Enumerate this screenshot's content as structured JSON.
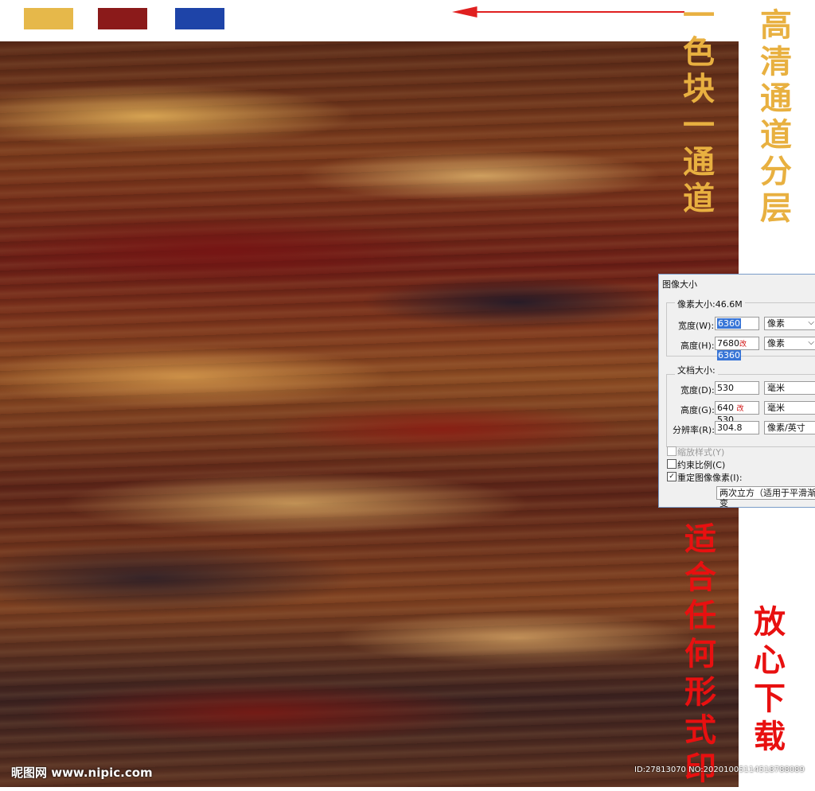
{
  "swatches": [
    {
      "name": "gold",
      "color": "#e6b84a"
    },
    {
      "name": "maroon",
      "color": "#8b1a1a"
    },
    {
      "name": "blue",
      "color": "#1e44a8"
    }
  ],
  "vertical_texts": {
    "left_top": [
      "一",
      "色",
      "块",
      "一",
      "通",
      "道"
    ],
    "right_top": [
      "高",
      "清",
      "通",
      "道",
      "分",
      "层"
    ],
    "left_bottom": [
      "适",
      "合",
      "任",
      "何",
      "形",
      "式",
      "印"
    ],
    "right_bottom": [
      "放",
      "心",
      "下",
      "载"
    ]
  },
  "dialog": {
    "title": "图像大小",
    "pixel_size_label": "像素大小:46.6M",
    "width_label": "宽度(W):",
    "width_value": "6360",
    "width_unit": "像素",
    "height_label": "高度(H):",
    "height_old": "7680",
    "height_mark": "改",
    "height_value": "6360",
    "height_unit": "像素",
    "doc_size_label": "文档大小:",
    "doc_width_label": "宽度(D):",
    "doc_width_value": "530",
    "doc_width_unit": "毫米",
    "doc_height_label": "高度(G):",
    "doc_height_old": "640",
    "doc_height_mark": "改",
    "doc_height_value": "530",
    "doc_height_unit": "毫米",
    "resolution_label": "分辨率(R):",
    "resolution_value": "304.8",
    "resolution_unit": "像素/英寸",
    "scale_styles_label": "缩放样式(Y)",
    "constrain_label": "约束比例(C)",
    "resample_label": "重定图像像素(I):",
    "resample_method": "两次立方（适用于平滑渐变"
  },
  "footer": {
    "logo": "昵图网 www.nipic.com",
    "id": "ID:27813070 NO:20201005114518788089"
  }
}
